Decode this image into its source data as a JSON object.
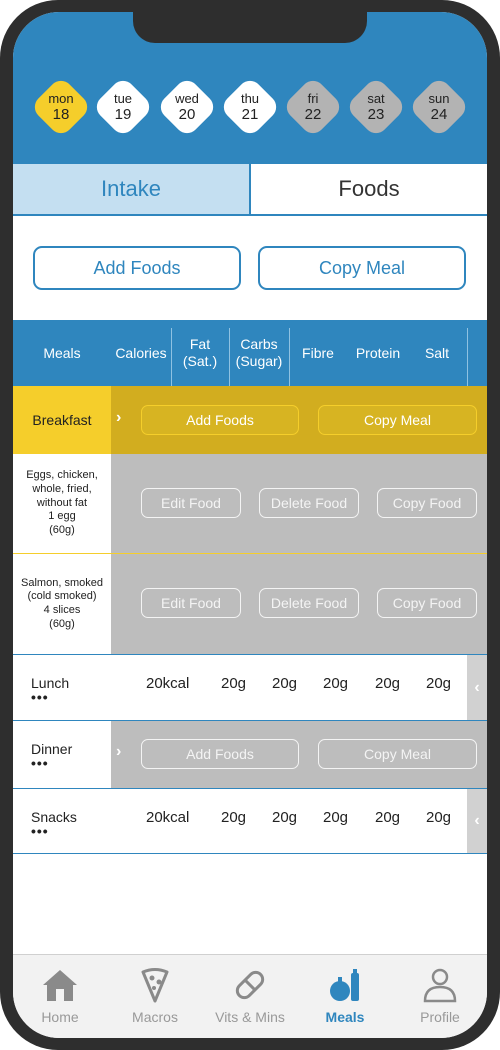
{
  "days": [
    {
      "name": "mon",
      "num": "18",
      "state": "active"
    },
    {
      "name": "tue",
      "num": "19",
      "state": "normal"
    },
    {
      "name": "wed",
      "num": "20",
      "state": "normal"
    },
    {
      "name": "thu",
      "num": "21",
      "state": "normal"
    },
    {
      "name": "fri",
      "num": "22",
      "state": "weekend"
    },
    {
      "name": "sat",
      "num": "23",
      "state": "weekend"
    },
    {
      "name": "sun",
      "num": "24",
      "state": "weekend"
    }
  ],
  "tabs": {
    "intake": "Intake",
    "foods": "Foods"
  },
  "actions": {
    "add_foods": "Add Foods",
    "copy_meal": "Copy Meal"
  },
  "columns": {
    "meals": "Meals",
    "calories": "Calories",
    "fat": "Fat",
    "fat_sub": "(Sat.)",
    "carbs": "Carbs",
    "carbs_sub": "(Sugar)",
    "fibre": "Fibre",
    "protein": "Protein",
    "salt": "Salt"
  },
  "breakfast": {
    "label": "Breakfast",
    "add_foods": "Add Foods",
    "copy_meal": "Copy Meal",
    "foods": [
      {
        "lines": [
          "Eggs, chicken,",
          "whole, fried,",
          "without fat",
          "1 egg",
          "(60g)"
        ],
        "edit": "Edit Food",
        "delete": "Delete Food",
        "copy": "Copy Food"
      },
      {
        "lines": [
          "Salmon, smoked",
          "(cold smoked)",
          "4 slices",
          "(60g)"
        ],
        "edit": "Edit Food",
        "delete": "Delete Food",
        "copy": "Copy Food"
      }
    ]
  },
  "lunch": {
    "label": "Lunch",
    "more": "•••",
    "calories": "20kcal",
    "fat": "20g",
    "carbs": "20g",
    "fibre": "20g",
    "protein": "20g",
    "salt": "20g"
  },
  "dinner": {
    "label": "Dinner",
    "more": "•••",
    "add_foods": "Add Foods",
    "copy_meal": "Copy Meal"
  },
  "snacks": {
    "label": "Snacks",
    "more": "•••",
    "calories": "20kcal",
    "fat": "20g",
    "carbs": "20g",
    "fibre": "20g",
    "protein": "20g",
    "salt": "20g"
  },
  "nav": [
    {
      "label": "Home",
      "icon": "home-icon"
    },
    {
      "label": "Macros",
      "icon": "pizza-slice-icon"
    },
    {
      "label": "Vits & Mins",
      "icon": "pill-icon"
    },
    {
      "label": "Meals",
      "icon": "meals-icon"
    },
    {
      "label": "Profile",
      "icon": "profile-icon"
    }
  ],
  "colors": {
    "primary": "#2f86be",
    "accent": "#f5ce2b",
    "muted": "#bdbdbd"
  }
}
